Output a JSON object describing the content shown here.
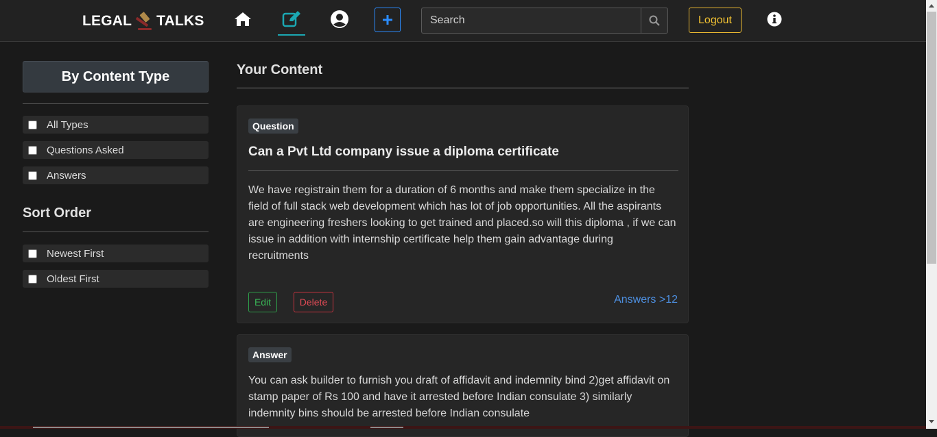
{
  "brand": {
    "left": "LEGAL",
    "right": "TALKS"
  },
  "nav": {
    "icons": [
      "home-icon",
      "edit-icon",
      "user-circle-icon",
      "plus-icon",
      "info-icon"
    ],
    "active": "edit-icon",
    "search": {
      "placeholder": "Search",
      "value": ""
    },
    "logout_label": "Logout",
    "colors": {
      "active_underline": "#1ba8b3",
      "plus_border": "#2b8cff",
      "logout": "#f2c232"
    }
  },
  "sidebar": {
    "content_type_title": "By Content Type",
    "content_type_options": [
      {
        "label": "All Types",
        "checked": false
      },
      {
        "label": "Questions Asked",
        "checked": false
      },
      {
        "label": "Answers",
        "checked": false
      }
    ],
    "sort_title": "Sort Order",
    "sort_options": [
      {
        "label": "Newest First",
        "checked": false
      },
      {
        "label": "Oldest First",
        "checked": false
      }
    ]
  },
  "main": {
    "title": "Your Content",
    "cards": [
      {
        "badge": "Question",
        "title": "Can a Pvt Ltd company issue a diploma certificate",
        "body_lines": [
          "We have registrain them for a duration of 6 months and make them specialize in the",
          "field of full stack web development which has lot of job opportunities. All the aspirants",
          "are engineering freshers looking to get trained and placed.so will this diploma , if we can",
          "issue in addition with internship certificate help them gain advantage during",
          "recruitments"
        ],
        "edit_label": "Edit",
        "delete_label": "Delete",
        "answers_link": "Answers >12"
      },
      {
        "badge": "Answer",
        "body_lines": [
          "You can ask builder to furnish you draft of affidavit and indemnity bind 2)get affidavit on",
          "stamp paper of Rs 100 and have it arrested before Indian consulate 3) similarly",
          "indemnity bins should be arrested before Indian consulate"
        ]
      }
    ]
  }
}
